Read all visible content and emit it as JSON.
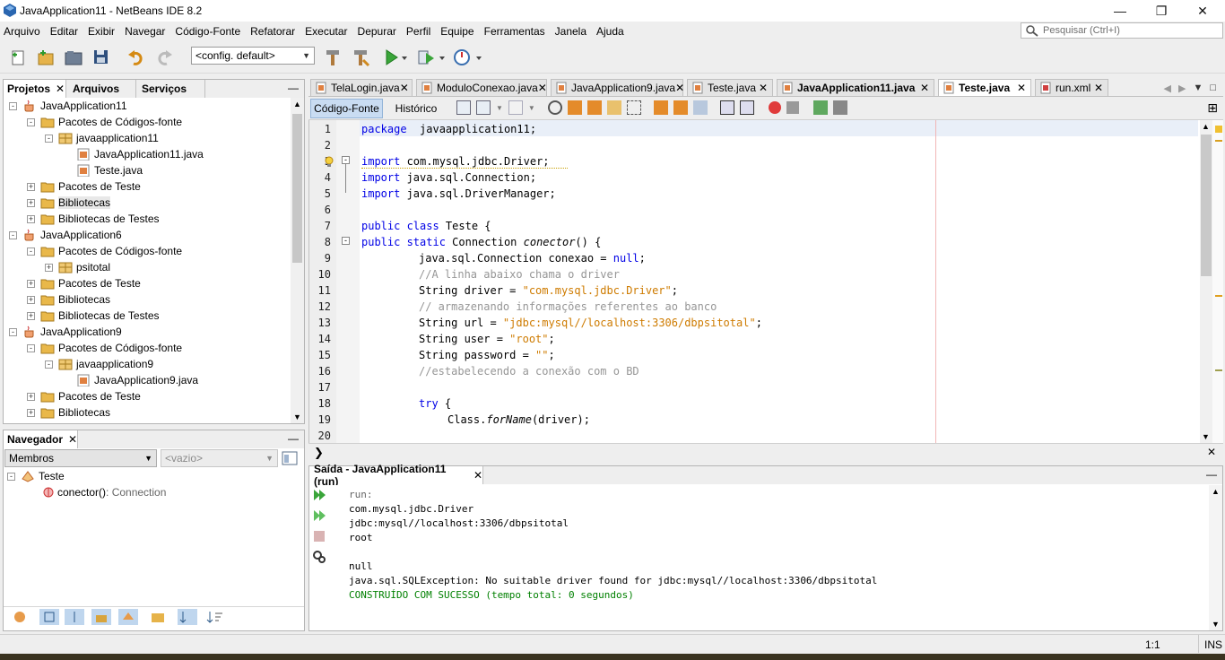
{
  "window": {
    "title": "JavaApplication11 - NetBeans IDE 8.2"
  },
  "menu": [
    "Arquivo",
    "Editar",
    "Exibir",
    "Navegar",
    "Código-Fonte",
    "Refatorar",
    "Executar",
    "Depurar",
    "Perfil",
    "Equipe",
    "Ferramentas",
    "Janela",
    "Ajuda"
  ],
  "search": {
    "placeholder": "Pesquisar (Ctrl+I)"
  },
  "toolbar": {
    "config": "<config. default>"
  },
  "projects_panel": {
    "tabs": [
      "Projetos",
      "Arquivos",
      "Serviços"
    ],
    "tree": [
      {
        "label": "JavaApplication11",
        "level": 0,
        "icon": "coffee-cup-icon",
        "exp": "-"
      },
      {
        "label": "Pacotes de Códigos-fonte",
        "level": 1,
        "icon": "folder-icon",
        "exp": "-"
      },
      {
        "label": "javaapplication11",
        "level": 2,
        "icon": "package-icon",
        "exp": "-"
      },
      {
        "label": "JavaApplication11.java",
        "level": 3,
        "icon": "java-file-icon",
        "exp": ""
      },
      {
        "label": "Teste.java",
        "level": 3,
        "icon": "java-file-icon",
        "exp": ""
      },
      {
        "label": "Pacotes de Teste",
        "level": 1,
        "icon": "folder-icon",
        "exp": "+"
      },
      {
        "label": "Bibliotecas",
        "level": 1,
        "icon": "folder-icon",
        "exp": "+"
      },
      {
        "label": "Bibliotecas de Testes",
        "level": 1,
        "icon": "folder-icon",
        "exp": "+"
      },
      {
        "label": "JavaApplication6",
        "level": 0,
        "icon": "coffee-cup-icon",
        "exp": "-"
      },
      {
        "label": "Pacotes de Códigos-fonte",
        "level": 1,
        "icon": "folder-icon",
        "exp": "-"
      },
      {
        "label": "psitotal",
        "level": 2,
        "icon": "package-icon",
        "exp": "+"
      },
      {
        "label": "Pacotes de Teste",
        "level": 1,
        "icon": "folder-icon",
        "exp": "+"
      },
      {
        "label": "Bibliotecas",
        "level": 1,
        "icon": "folder-icon",
        "exp": "+"
      },
      {
        "label": "Bibliotecas de Testes",
        "level": 1,
        "icon": "folder-icon",
        "exp": "+"
      },
      {
        "label": "JavaApplication9",
        "level": 0,
        "icon": "coffee-cup-icon",
        "exp": "-"
      },
      {
        "label": "Pacotes de Códigos-fonte",
        "level": 1,
        "icon": "folder-icon",
        "exp": "-"
      },
      {
        "label": "javaapplication9",
        "level": 2,
        "icon": "package-icon",
        "exp": "-"
      },
      {
        "label": "JavaApplication9.java",
        "level": 3,
        "icon": "java-file-icon",
        "exp": ""
      },
      {
        "label": "Pacotes de Teste",
        "level": 1,
        "icon": "folder-icon",
        "exp": "+"
      },
      {
        "label": "Bibliotecas",
        "level": 1,
        "icon": "folder-icon",
        "exp": "+"
      }
    ]
  },
  "navigator": {
    "title": "Navegador",
    "filter": "Membros",
    "filter2": "<vazio>",
    "root": "Teste",
    "member": "conector()",
    "member_type": " : Connection"
  },
  "editor": {
    "tabs": [
      {
        "label": "TelaLogin.java",
        "active": false
      },
      {
        "label": "ModuloConexao.java",
        "active": false
      },
      {
        "label": "JavaApplication9.java",
        "active": false
      },
      {
        "label": "Teste.java",
        "active": false
      },
      {
        "label": "JavaApplication11.java",
        "active": false,
        "bold": true
      },
      {
        "label": "Teste.java",
        "active": true,
        "bold": true
      },
      {
        "label": "run.xml",
        "active": false
      }
    ],
    "subtabs": [
      "Código-Fonte",
      "Histórico"
    ],
    "lines": [
      {
        "n": "1",
        "indent": 0,
        "parts": [
          [
            "kw",
            "package"
          ],
          [
            "",
            "  javaapplication11;"
          ]
        ]
      },
      {
        "n": "2",
        "indent": 0,
        "parts": []
      },
      {
        "n": "3",
        "indent": 0,
        "parts": [
          [
            "kw",
            "import"
          ],
          [
            "",
            " com.mysql.jdbc.Driver;"
          ]
        ]
      },
      {
        "n": "4",
        "indent": 0,
        "parts": [
          [
            "kw",
            "import"
          ],
          [
            "",
            " java.sql.Connection;"
          ]
        ]
      },
      {
        "n": "5",
        "indent": 0,
        "parts": [
          [
            "kw",
            "import"
          ],
          [
            "",
            " java.sql.DriverManager;"
          ]
        ]
      },
      {
        "n": "6",
        "indent": 0,
        "parts": []
      },
      {
        "n": "7",
        "indent": 0,
        "parts": [
          [
            "kw",
            "public class"
          ],
          [
            "",
            " Teste {"
          ]
        ]
      },
      {
        "n": "8",
        "indent": 0,
        "parts": [
          [
            "kw",
            "public static"
          ],
          [
            "",
            " Connection "
          ],
          [
            "it",
            "conector"
          ],
          [
            "",
            "() {"
          ]
        ]
      },
      {
        "n": "9",
        "indent": 8,
        "parts": [
          [
            "",
            "java.sql.Connection conexao = "
          ],
          [
            "kw",
            "null"
          ],
          [
            "",
            ";"
          ]
        ]
      },
      {
        "n": "10",
        "indent": 8,
        "parts": [
          [
            "cm",
            "//A linha abaixo chama o driver"
          ]
        ]
      },
      {
        "n": "11",
        "indent": 8,
        "parts": [
          [
            "",
            "String driver = "
          ],
          [
            "str",
            "\"com.mysql.jdbc.Driver\""
          ],
          [
            "",
            ";"
          ]
        ]
      },
      {
        "n": "12",
        "indent": 8,
        "parts": [
          [
            "cm",
            "// armazenando informações referentes ao banco"
          ]
        ]
      },
      {
        "n": "13",
        "indent": 8,
        "parts": [
          [
            "",
            "String url = "
          ],
          [
            "str",
            "\"jdbc:mysql//localhost:3306/dbpsitotal\""
          ],
          [
            "",
            ";"
          ]
        ]
      },
      {
        "n": "14",
        "indent": 8,
        "parts": [
          [
            "",
            "String user = "
          ],
          [
            "str",
            "\"root\""
          ],
          [
            "",
            ";"
          ]
        ]
      },
      {
        "n": "15",
        "indent": 8,
        "parts": [
          [
            "",
            "String password = "
          ],
          [
            "str",
            "\"\""
          ],
          [
            "",
            ";"
          ]
        ]
      },
      {
        "n": "16",
        "indent": 8,
        "parts": [
          [
            "cm",
            "//estabelecendo a conexão com o BD"
          ]
        ]
      },
      {
        "n": "17",
        "indent": 0,
        "parts": []
      },
      {
        "n": "18",
        "indent": 8,
        "parts": [
          [
            "kw",
            "try"
          ],
          [
            "",
            " {"
          ]
        ]
      },
      {
        "n": "19",
        "indent": 12,
        "parts": [
          [
            "",
            "Class."
          ],
          [
            "it",
            "forName"
          ],
          [
            "",
            "(driver);"
          ]
        ]
      },
      {
        "n": "20",
        "indent": 0,
        "parts": []
      }
    ]
  },
  "output": {
    "title": "Saída - JavaApplication11 (run)",
    "lines": [
      {
        "text": "run:",
        "color": "#666666"
      },
      {
        "text": "com.mysql.jdbc.Driver",
        "color": "#000000"
      },
      {
        "text": "jdbc:mysql//localhost:3306/dbpsitotal",
        "color": "#000000"
      },
      {
        "text": "root",
        "color": "#000000"
      },
      {
        "text": "",
        "color": "#000000"
      },
      {
        "text": "null",
        "color": "#000000"
      },
      {
        "text": "java.sql.SQLException: No suitable driver found for jdbc:mysql//localhost:3306/dbpsitotal",
        "color": "#000000"
      },
      {
        "text": "CONSTRUÍDO COM SUCESSO (tempo total: 0 segundos)",
        "color": "#008000"
      }
    ]
  },
  "status": {
    "position": "1:1",
    "mode": "INS"
  }
}
